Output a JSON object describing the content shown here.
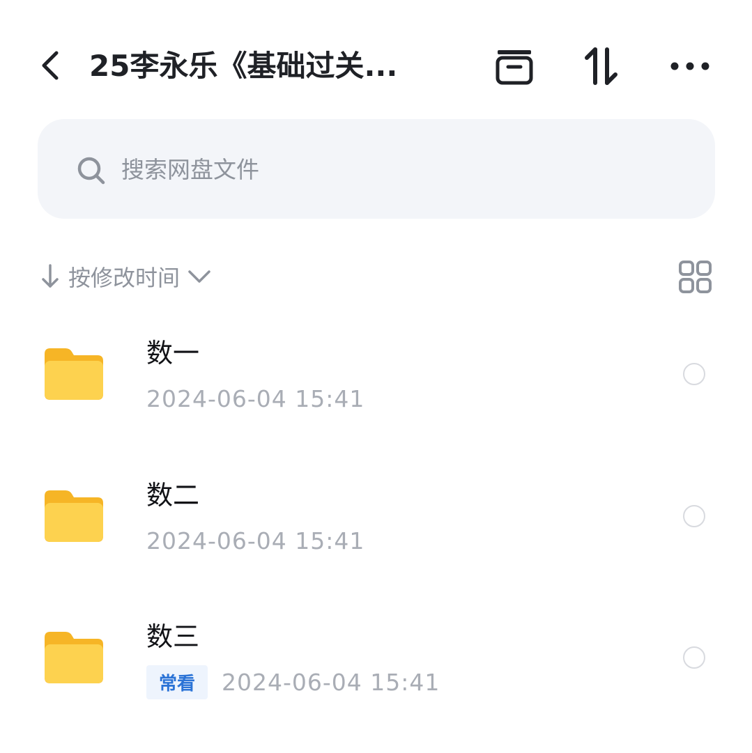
{
  "header": {
    "title": "25李永乐《基础过关...",
    "back_icon": "back-arrow-icon",
    "actions": [
      "archive-icon",
      "sort-toggle-icon",
      "more-icon"
    ]
  },
  "search": {
    "placeholder": "搜索网盘文件"
  },
  "sort": {
    "label": "按修改时间"
  },
  "files": [
    {
      "name": "数一",
      "date": "2024-06-04  15:41",
      "tag": ""
    },
    {
      "name": "数二",
      "date": "2024-06-04  15:41",
      "tag": ""
    },
    {
      "name": "数三",
      "date": "2024-06-04  15:41",
      "tag": "常看"
    }
  ],
  "colors": {
    "folder": "#fccb3c",
    "tag_text": "#2b73d6",
    "tag_bg": "#eef4fd",
    "muted": "#8e939c"
  }
}
